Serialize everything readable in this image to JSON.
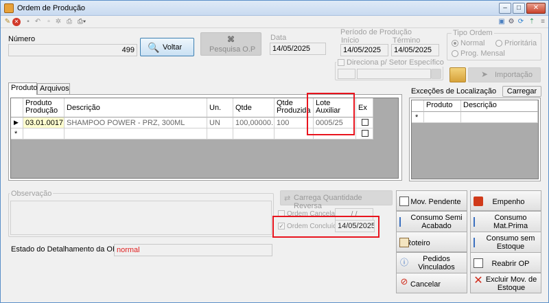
{
  "window": {
    "title": "Ordem de Produção"
  },
  "header": {
    "numero_label": "Número",
    "numero_value": "499",
    "voltar_label": "Voltar",
    "pesquisa_label": "Pesquisa O.P",
    "data_label": "Data",
    "data_value": "14/05/2025",
    "periodo_label": "Período de Produção",
    "inicio_label": "Início",
    "inicio_value": "14/05/2025",
    "termino_label": "Término",
    "termino_value": "14/05/2025",
    "tipo_label": "Tipo Ordem",
    "tipo_options": [
      "Normal",
      "Prioritária",
      "Prog. Mensal"
    ],
    "direciona_label": "Direciona p/ Setor Específico",
    "importacao_label": "Importação"
  },
  "tabs": [
    "Produto",
    "Arquivos"
  ],
  "grid": {
    "columns": [
      "Produto Produção",
      "Descrição",
      "Un.",
      "Qtde",
      "Qtde Produzida",
      "Lote Auxiliar",
      "Ex"
    ],
    "rows": [
      {
        "produto": "03.01.0017",
        "descricao": "SHAMPOO POWER - PRZ, 300ML",
        "un": "UN",
        "qtde": "100,00000...",
        "qtde_produzida": "100",
        "lote": "0005/25"
      }
    ]
  },
  "excecoes": {
    "title": "Exceções de Localização",
    "carregar_label": "Carregar",
    "columns": [
      "Produto",
      "Descrição"
    ]
  },
  "observacao": {
    "label": "Observação"
  },
  "carrega_label": "Carrega Quantidade Reversa",
  "ordem_cancelada": {
    "label": "Ordem Cancelada",
    "value": "/ /"
  },
  "ordem_concluida": {
    "label": "Ordem Concluída",
    "value": "14/05/2025"
  },
  "estado": {
    "label": "Estado do Detalhamento da OP:",
    "value": "normal"
  },
  "actions": {
    "mov_pendente": "Mov. Pendente",
    "empenho": "Empenho",
    "consumo_semi": "Consumo Semi Acabado",
    "consumo_mat": "Consumo Mat.Prima",
    "roteiro": "Roteiro",
    "consumo_sem": "Consumo sem Estoque",
    "pedidos": "Pedidos Vinculados",
    "reabrir": "Reabrir OP",
    "cancelar": "Cancelar",
    "excluir": "Excluir Mov. de Estoque"
  }
}
